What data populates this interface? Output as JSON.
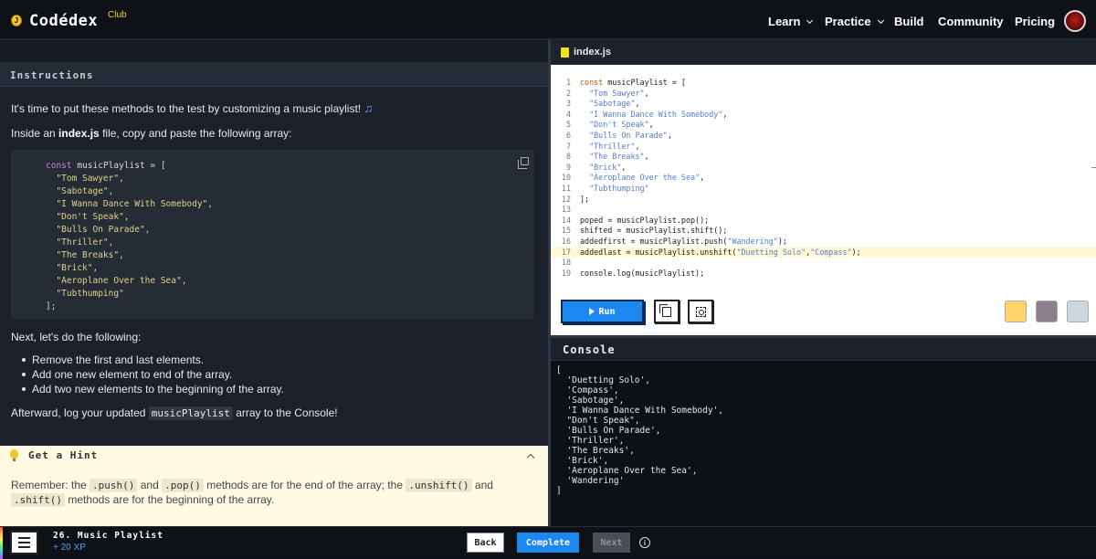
{
  "nav": {
    "logo_glyph": "J",
    "logo": "Codédex",
    "logo_badge": "Club",
    "items": [
      {
        "label": "Learn",
        "dropdown": true
      },
      {
        "label": "Practice",
        "dropdown": true
      },
      {
        "label": "Build",
        "dropdown": false
      },
      {
        "label": "Community",
        "dropdown": false
      },
      {
        "label": "Pricing",
        "dropdown": false
      }
    ]
  },
  "instructions": {
    "header": "Instructions",
    "intro": "It's time to put these methods to the test by customizing a music playlist!",
    "intro_emoji": "♫",
    "copy_line_pre": "Inside an ",
    "copy_line_file": "index.js",
    "copy_line_post": " file, copy and paste the following array:",
    "code_lines": [
      "const musicPlaylist = [",
      "  \"Tom Sawyer\",",
      "  \"Sabotage\",",
      "  \"I Wanna Dance With Somebody\",",
      "  \"Don't Speak\",",
      "  \"Bulls On Parade\",",
      "  \"Thriller\",",
      "  \"The Breaks\",",
      "  \"Brick\",",
      "  \"Aeroplane Over the Sea\",",
      "  \"Tubthumping\"",
      "];"
    ],
    "next_label": "Next, let's do the following:",
    "tasks": [
      "Remove the first and last elements.",
      "Add one new element to end of the array.",
      "Add two new elements to the beginning of the array."
    ],
    "after_pre": "Afterward, log your updated ",
    "after_code": "musicPlaylist",
    "after_post": " array to the Console!"
  },
  "hint": {
    "title": "Get a Hint",
    "parts": {
      "a": "Remember: the ",
      "push": ".push()",
      "and1": " and ",
      "pop": ".pop()",
      "b": " methods are for the end of the array; the ",
      "unshift": ".unshift()",
      "and2": " and ",
      "shift": ".shift()",
      "c": " methods are for the beginning of the array."
    }
  },
  "editor": {
    "filename": "index.js",
    "highlight_line": 17,
    "lines": [
      {
        "n": "1",
        "code": "const musicPlaylist = ["
      },
      {
        "n": "2",
        "code": "  \"Tom Sawyer\","
      },
      {
        "n": "3",
        "code": "  \"Sabotage\","
      },
      {
        "n": "4",
        "code": "  \"I Wanna Dance With Somebody\","
      },
      {
        "n": "5",
        "code": "  \"Don't Speak\","
      },
      {
        "n": "6",
        "code": "  \"Bulls On Parade\","
      },
      {
        "n": "7",
        "code": "  \"Thriller\","
      },
      {
        "n": "8",
        "code": "  \"The Breaks\","
      },
      {
        "n": "9",
        "code": "  \"Brick\","
      },
      {
        "n": "10",
        "code": "  \"Aeroplane Over the Sea\","
      },
      {
        "n": "11",
        "code": "  \"Tubthumping\""
      },
      {
        "n": "12",
        "code": "];"
      },
      {
        "n": "13",
        "code": ""
      },
      {
        "n": "14",
        "code": "poped = musicPlaylist.pop();"
      },
      {
        "n": "15",
        "code": "shifted = musicPlaylist.shift();"
      },
      {
        "n": "16",
        "code": "addedfirst = musicPlaylist.push(\"Wandering\");"
      },
      {
        "n": "17",
        "code": "addedlast = musicPlaylist.unshift(\"Duetting Solo\",\"Compass\");"
      },
      {
        "n": "18",
        "code": ""
      },
      {
        "n": "19",
        "code": "console.log(musicPlaylist);"
      }
    ],
    "run_label": "Run"
  },
  "console": {
    "title": "Console",
    "output": "[\n  'Duetting Solo',\n  'Compass',\n  'Sabotage',\n  'I Wanna Dance With Somebody',\n  \"Don't Speak\",\n  'Bulls On Parade',\n  'Thriller',\n  'The Breaks',\n  'Brick',\n  'Aeroplane Over the Sea',\n  'Wandering'\n]"
  },
  "footer": {
    "lesson": "26. Music Playlist",
    "xp": "+ 20 XP",
    "back": "Back",
    "complete": "Complete",
    "next": "Next",
    "info_glyph": "i"
  },
  "colors": {
    "accent_blue": "#1d87f0",
    "hint_bg": "#fffbe3",
    "badge_yellow": "#f5d020"
  },
  "icons": [
    "hamburger-icon",
    "copy-icon",
    "screenshot-icon",
    "info-icon",
    "lightbulb-icon",
    "js-file-icon"
  ]
}
